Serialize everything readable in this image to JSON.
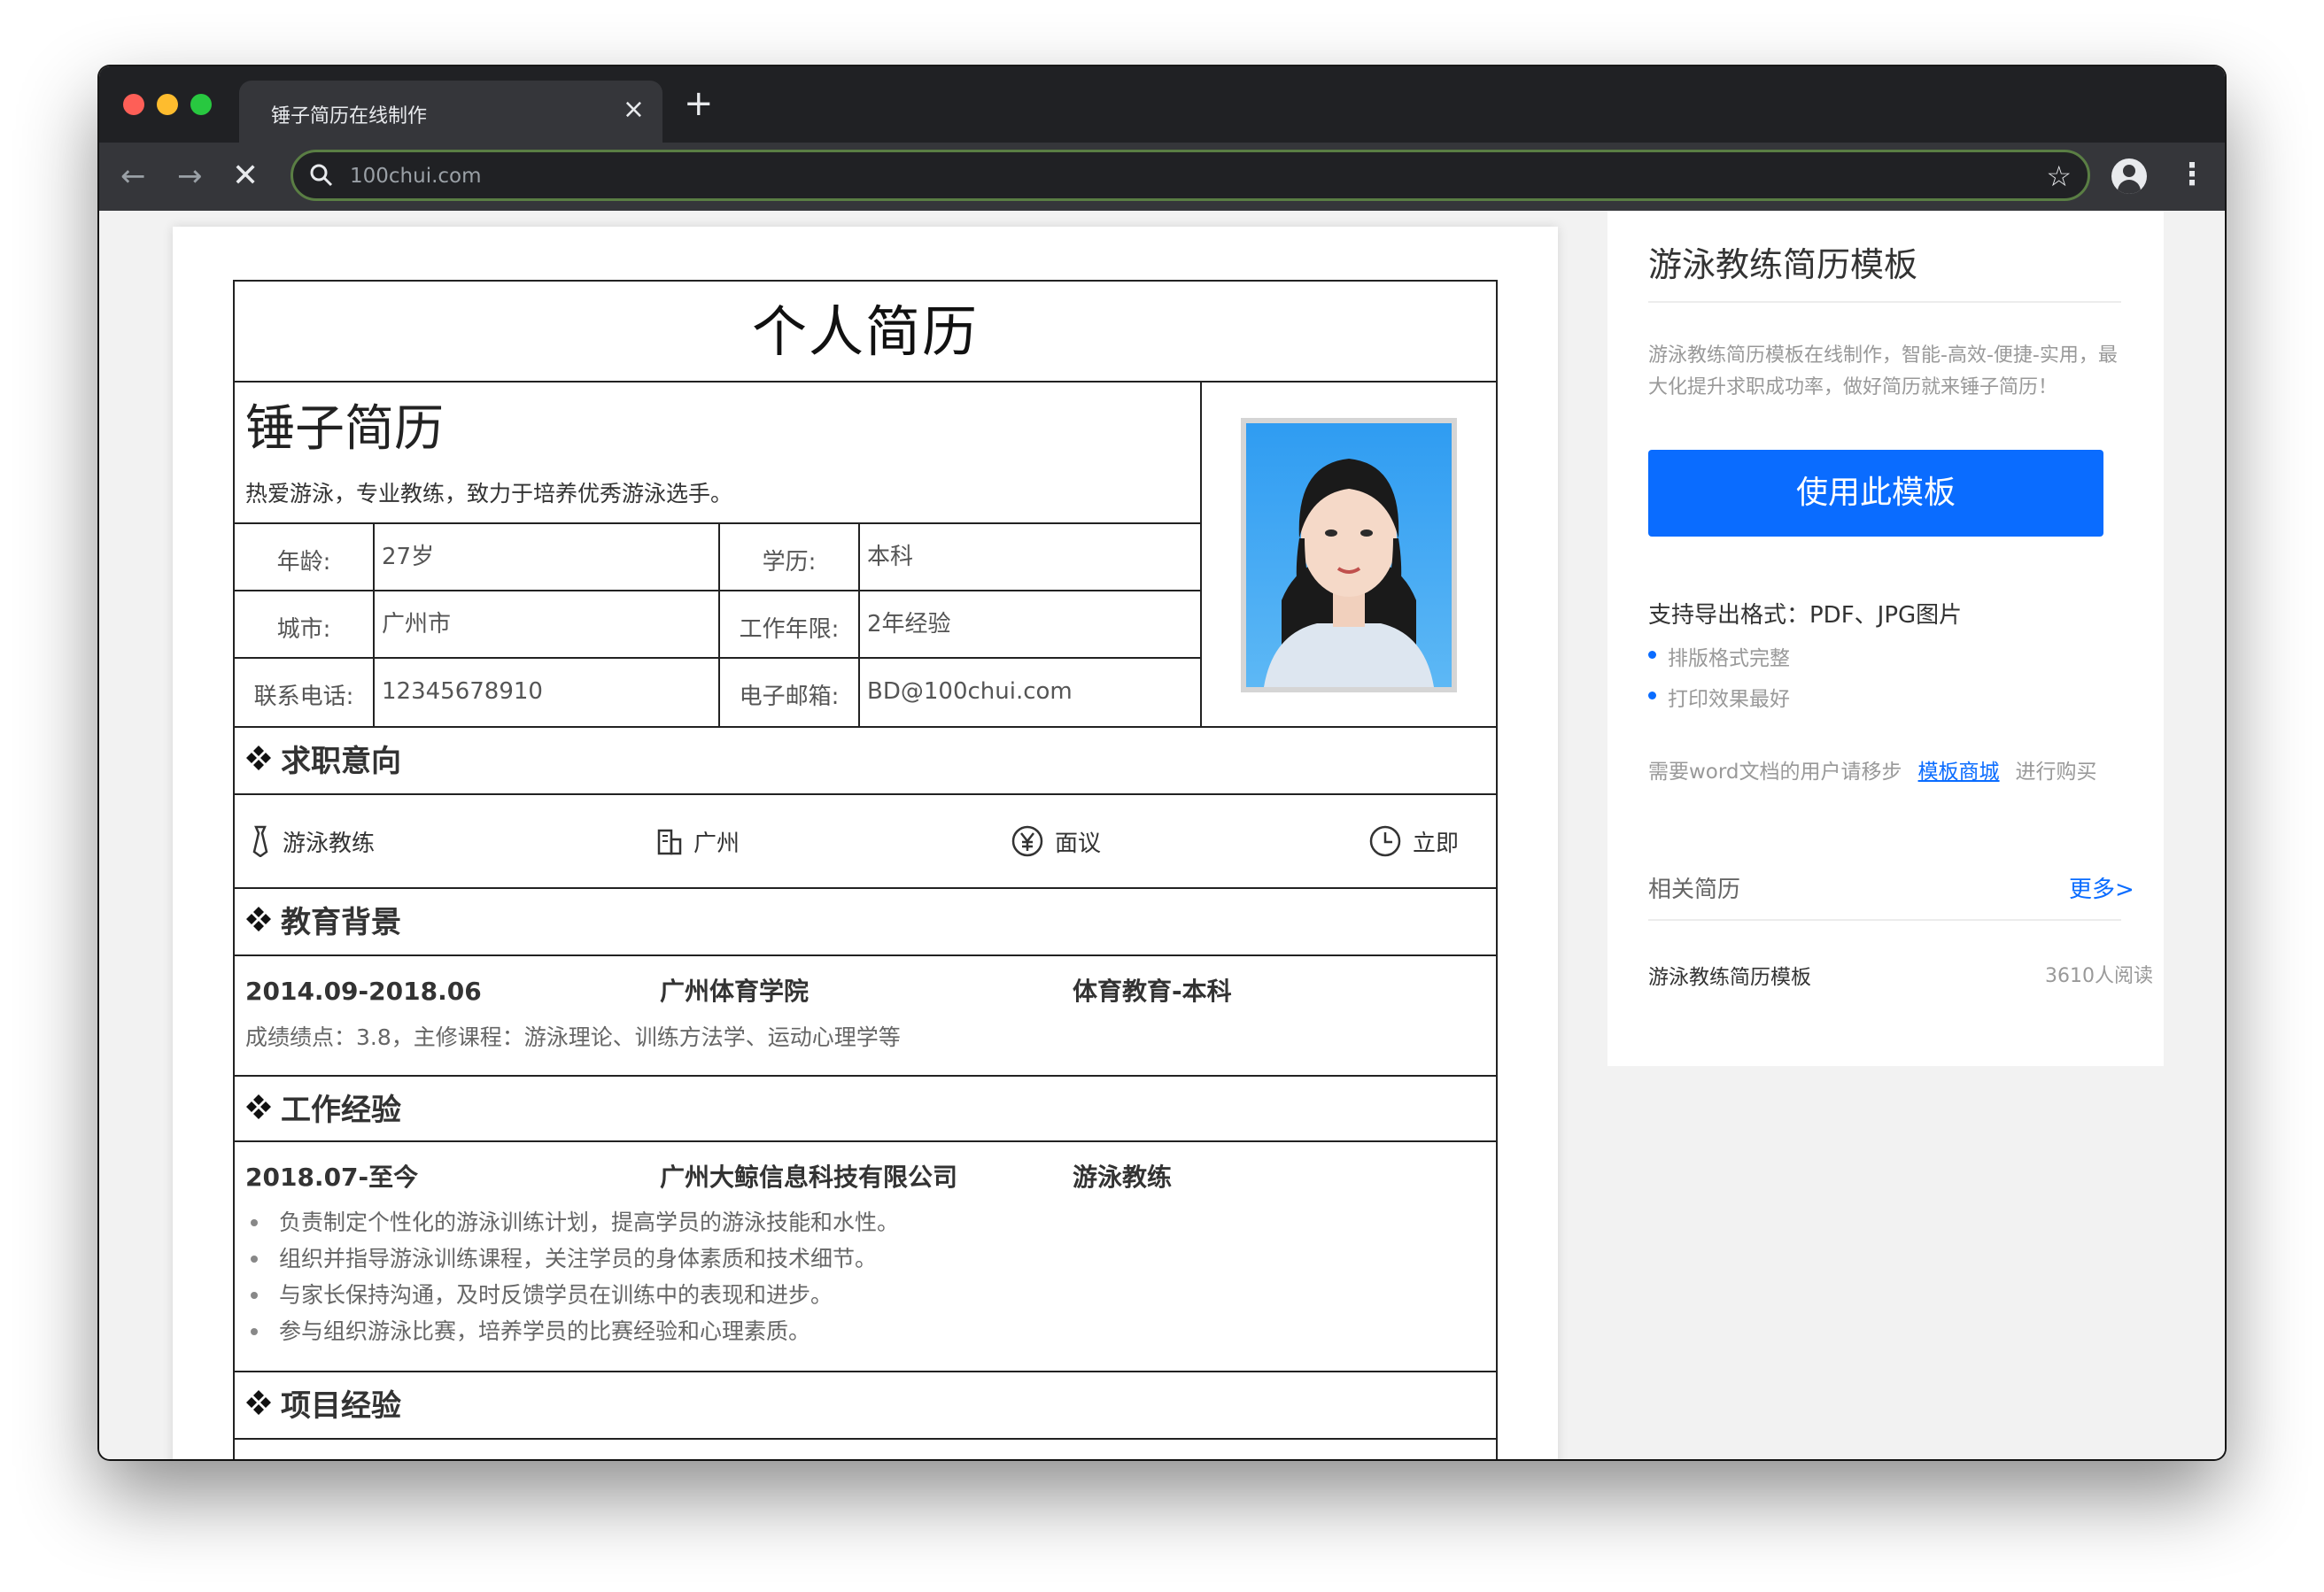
{
  "browser": {
    "tab_title": "锤子简历在线制作",
    "tab_close": "×",
    "new_tab": "+",
    "url": "100chui.com",
    "back": "←",
    "forward": "→",
    "stop": "✕",
    "star": "☆",
    "menu": "⋮"
  },
  "resume": {
    "title": "个人简历",
    "name": "锤子简历",
    "slogan": "热爱游泳，专业教练，致力于培养优秀游泳选手。",
    "info": [
      {
        "label1": "年龄:",
        "value1": "27岁",
        "label2": "学历:",
        "value2": "本科"
      },
      {
        "label1": "城市:",
        "value1": "广州市",
        "label2": "工作年限:",
        "value2": "2年经验"
      },
      {
        "label1": "联系电话:",
        "value1": "12345678910",
        "label2": "电子邮箱:",
        "value2": "BD@100chui.com"
      }
    ],
    "sections": {
      "intent": "求职意向",
      "education": "教育背景",
      "work": "工作经验",
      "project": "项目经验"
    },
    "intent": {
      "position": "游泳教练",
      "city": "广州",
      "salary": "面议",
      "availability": "立即"
    },
    "education": {
      "period": "2014.09-2018.06",
      "school": "广州体育学院",
      "major": "体育教育-本科",
      "detail": "成绩绩点：3.8，主修课程：游泳理论、训练方法学、运动心理学等"
    },
    "work": {
      "period": "2018.07-至今",
      "company": "广州大鲸信息科技有限公司",
      "role": "游泳教练",
      "bullets": [
        "负责制定个性化的游泳训练计划，提高学员的游泳技能和水性。",
        "组织并指导游泳训练课程，关注学员的身体素质和技术细节。",
        "与家长保持沟通，及时反馈学员在训练中的表现和进步。",
        "参与组织游泳比赛，培养学员的比赛经验和心理素质。"
      ]
    }
  },
  "sidebar": {
    "title": "游泳教练简历模板",
    "desc": "游泳教练简历模板在线制作，智能-高效-便捷-实用，最大化提升求职成功率，做好简历就来锤子简历！",
    "use_button": "使用此模板",
    "formats": "支持导出格式：PDF、JPG图片",
    "bullet1": "排版格式完整",
    "bullet2": "打印效果最好",
    "word_prefix": "需要word文档的用户请移步",
    "word_link": "模板商城",
    "word_suffix": "进行购买",
    "related": "相关简历",
    "more": "更多>",
    "related_item": "游泳教练简历模板",
    "related_reads": "3610人阅读"
  },
  "colors": {
    "accent": "#0a6cff",
    "titlebar": "#202124",
    "toolbar": "#35363a",
    "omnibox_border": "#5a7e44"
  }
}
